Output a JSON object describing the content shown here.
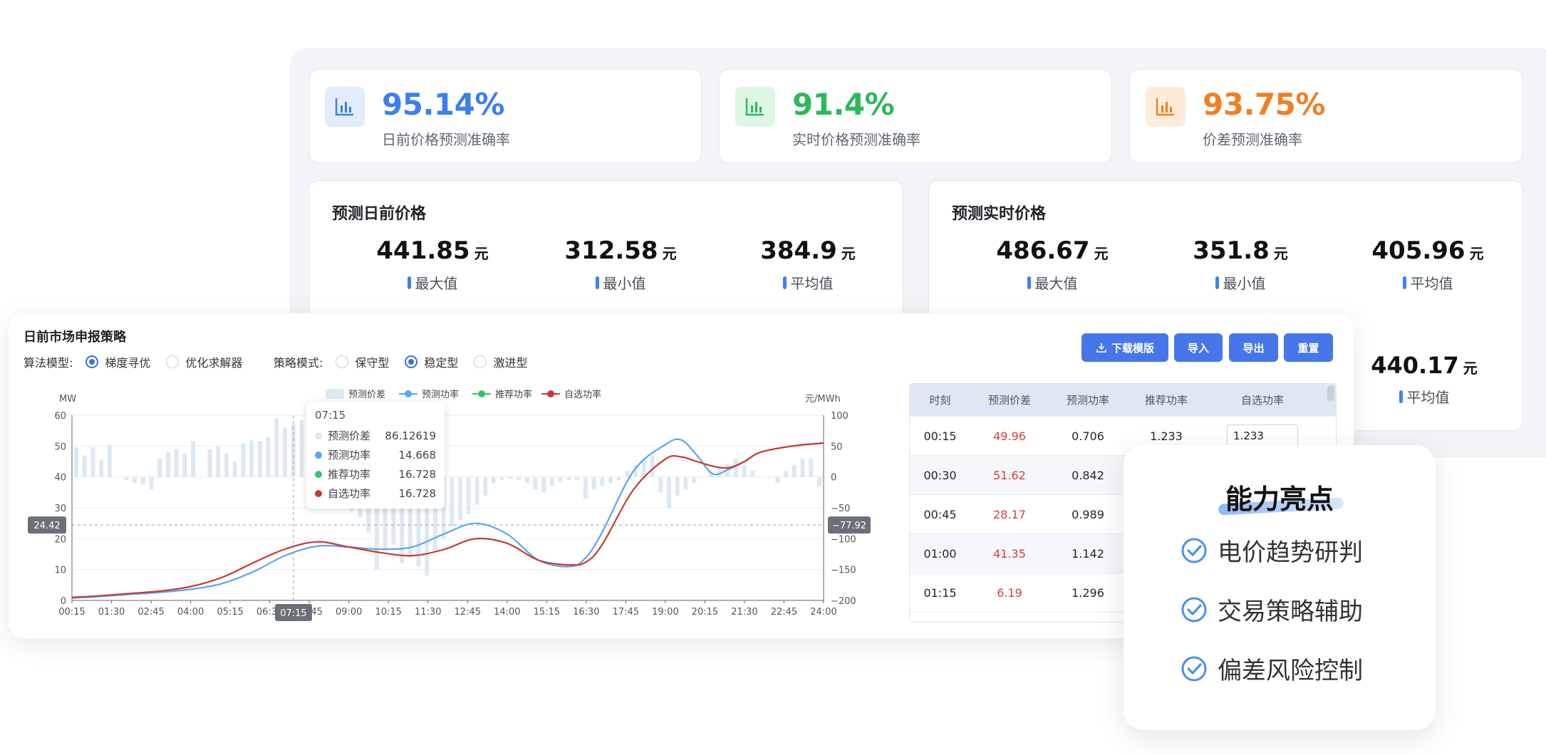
{
  "stats": [
    {
      "value": "95.14%",
      "label": "日前价格预测准确率",
      "color": "#3b7ff0",
      "bg": "#e2ecfd",
      "icon": "bar-chart-icon"
    },
    {
      "value": "91.4%",
      "label": "实时价格预测准确率",
      "color": "#2fb85a",
      "bg": "#ddf6e5",
      "icon": "bar-chart-icon"
    },
    {
      "value": "93.75%",
      "label": "价差预测准确率",
      "color": "#f07f24",
      "bg": "#fdebd9",
      "icon": "bar-chart-icon"
    }
  ],
  "dayahead": {
    "title": "预测日前价格",
    "items": [
      {
        "value": "441.85",
        "unit": "元",
        "label": "最大值"
      },
      {
        "value": "312.58",
        "unit": "元",
        "label": "最小值"
      },
      {
        "value": "384.9",
        "unit": "元",
        "label": "平均值"
      }
    ]
  },
  "realtime": {
    "title": "预测实时价格",
    "items": [
      {
        "value": "486.67",
        "unit": "元",
        "label": "最大值"
      },
      {
        "value": "351.8",
        "unit": "元",
        "label": "最小值"
      },
      {
        "value": "405.96",
        "unit": "元",
        "label": "平均值"
      }
    ],
    "extra": {
      "value": "440.17",
      "unit": "元",
      "label": "平均值"
    }
  },
  "strategy": {
    "title": "日前市场申报策略",
    "algo_label": "算法模型:",
    "algo_options": [
      "梯度寻优",
      "优化求解器"
    ],
    "algo_selected": 0,
    "mode_label": "策略模式:",
    "mode_options": [
      "保守型",
      "稳定型",
      "激进型"
    ],
    "mode_selected": 1,
    "buttons": {
      "download": "下载模版",
      "import": "导入",
      "export": "导出",
      "reset": "重置"
    }
  },
  "chart_data": {
    "type": "line",
    "ylabel_left": "MW",
    "ylabel_right": "元/MWh",
    "ylim_left": [
      0,
      60
    ],
    "ylim_right": [
      -200,
      100
    ],
    "yticks_left": [
      "0",
      "10",
      "20",
      "30",
      "40",
      "50",
      "60"
    ],
    "yticks_right": [
      "−200",
      "−150",
      "−100",
      "−50",
      "0",
      "50",
      "100"
    ],
    "xticks": [
      "00:15",
      "01:30",
      "02:45",
      "04:00",
      "05:15",
      "06:30",
      "07:45",
      "09:00",
      "10:15",
      "11:30",
      "12:45",
      "14:00",
      "15:15",
      "16:30",
      "17:45",
      "19:00",
      "20:15",
      "21:30",
      "22:45",
      "24:00"
    ],
    "legend": [
      "预测价差",
      "预测功率",
      "推荐功率",
      "自选功率"
    ],
    "legend_colors": [
      "#dde8f3",
      "#5aa5ee",
      "#34c46a",
      "#c83a2e"
    ],
    "hours": [
      0.25,
      1,
      2,
      3,
      4,
      5,
      6,
      7,
      8,
      9,
      10,
      11,
      12,
      13,
      14,
      15,
      16,
      16.5,
      17,
      18,
      19,
      19.5,
      20,
      20.5,
      21,
      21.5,
      22,
      23,
      24
    ],
    "series": [
      {
        "name": "预测功率",
        "values": [
          0.8,
          1.2,
          1.9,
          2.6,
          3.6,
          5.5,
          9.4,
          14.6,
          17.6,
          17.3,
          16.6,
          17.3,
          21.5,
          25.0,
          21.5,
          13.0,
          11.0,
          14.0,
          22.0,
          42.0,
          50.5,
          52.0,
          47.0,
          41.0,
          42.5,
          45.0,
          48.0,
          50.0,
          51.0
        ]
      },
      {
        "name": "自选功率",
        "values": [
          1.0,
          1.4,
          2.2,
          3.0,
          4.5,
          7.5,
          12.3,
          16.7,
          19.0,
          17.3,
          15.5,
          14.5,
          16.5,
          20.0,
          18.5,
          13.0,
          11.5,
          12.5,
          18.0,
          36.0,
          45.8,
          46.5,
          45.0,
          43.5,
          43.0,
          45.0,
          48.0,
          50.0,
          51.0
        ]
      }
    ],
    "bars_price_diff": [
      48,
      35,
      48,
      28,
      52,
      0,
      -5,
      -10,
      -12,
      -20,
      30,
      40,
      45,
      38,
      58,
      0,
      45,
      50,
      38,
      25,
      55,
      60,
      58,
      65,
      95,
      80,
      85,
      92,
      60,
      45,
      42,
      -20,
      -40,
      -55,
      -65,
      -90,
      -150,
      -120,
      -110,
      -140,
      -130,
      -145,
      -160,
      -120,
      -100,
      -80,
      -70,
      -60,
      -45,
      -30,
      -10,
      -5,
      -3,
      -5,
      -10,
      -20,
      -25,
      -15,
      -8,
      -5,
      -5,
      -35,
      -20,
      -15,
      -10,
      -5,
      10,
      20,
      30,
      35,
      -25,
      -50,
      -30,
      -20,
      -10,
      0,
      10,
      15,
      20,
      30,
      20,
      10,
      0,
      0,
      -10,
      10,
      20,
      30,
      30,
      -15
    ],
    "crosshair": {
      "x_label": "07:15",
      "left_value": "24.42",
      "right_value": "−77.92"
    },
    "tooltip": {
      "title": "07:15",
      "rows": [
        {
          "name": "预测价差",
          "value": "86.12619",
          "color": "#dde8f3"
        },
        {
          "name": "预测功率",
          "value": "14.668",
          "color": "#5aa5ee"
        },
        {
          "name": "推荐功率",
          "value": "16.728",
          "color": "#34c46a"
        },
        {
          "name": "自选功率",
          "value": "16.728",
          "color": "#c83a2e"
        }
      ]
    }
  },
  "table": {
    "headers": [
      "时刻",
      "预测价差",
      "预测功率",
      "推荐功率",
      "自选功率"
    ],
    "rows": [
      {
        "time": "00:15",
        "diff": "49.96",
        "power": "0.706",
        "rec": "1.233",
        "own": "1.233"
      },
      {
        "time": "00:30",
        "diff": "51.62",
        "power": "0.842",
        "rec": "",
        "own": ""
      },
      {
        "time": "00:45",
        "diff": "28.17",
        "power": "0.989",
        "rec": "",
        "own": ""
      },
      {
        "time": "01:00",
        "diff": "41.35",
        "power": "1.142",
        "rec": "",
        "own": ""
      },
      {
        "time": "01:15",
        "diff": "6.19",
        "power": "1.296",
        "rec": "",
        "own": ""
      }
    ]
  },
  "capability": {
    "title": "能力亮点",
    "items": [
      "电价趋势研判",
      "交易策略辅助",
      "偏差风险控制"
    ],
    "check_color": "#4a8ff0"
  }
}
